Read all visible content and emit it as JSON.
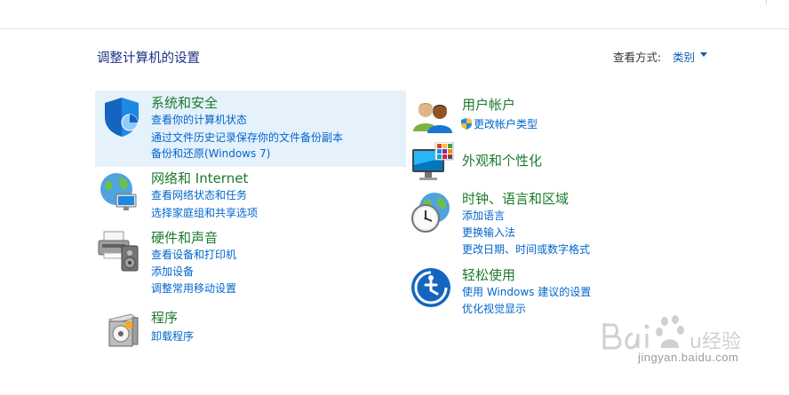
{
  "page": {
    "title": "调整计算机的设置",
    "view_by_label": "查看方式:",
    "view_by_value": "类别"
  },
  "left_categories": [
    {
      "title": "系统和安全",
      "icon": "shield-icon",
      "links": [
        "查看你的计算机状态",
        "通过文件历史记录保存你的文件备份副本",
        "备份和还原(Windows 7)"
      ]
    },
    {
      "title": "网络和 Internet",
      "icon": "network-globe-icon",
      "links": [
        "查看网络状态和任务",
        "选择家庭组和共享选项"
      ]
    },
    {
      "title": "硬件和声音",
      "icon": "printer-speaker-icon",
      "links": [
        "查看设备和打印机",
        "添加设备",
        "调整常用移动设置"
      ]
    },
    {
      "title": "程序",
      "icon": "programs-icon",
      "links": [
        "卸载程序"
      ]
    }
  ],
  "right_categories": [
    {
      "title": "用户帐户",
      "icon": "users-icon",
      "links": [
        "更改帐户类型"
      ]
    },
    {
      "title": "外观和个性化",
      "icon": "monitor-palette-icon",
      "links": []
    },
    {
      "title": "时钟、语言和区域",
      "icon": "clock-globe-icon",
      "links": [
        "添加语言",
        "更换输入法",
        "更改日期、时间或数字格式"
      ]
    },
    {
      "title": "轻松使用",
      "icon": "ease-of-access-icon",
      "links": [
        "使用 Windows 建议的设置",
        "优化视觉显示"
      ]
    }
  ],
  "watermark": {
    "brand": "Baidu经验",
    "url": "jingyan.baidu.com"
  },
  "colors": {
    "category_title": "#1d7a2d",
    "link": "#0066cc",
    "page_title": "#1e3287",
    "highlight": "#e5f1fb"
  }
}
